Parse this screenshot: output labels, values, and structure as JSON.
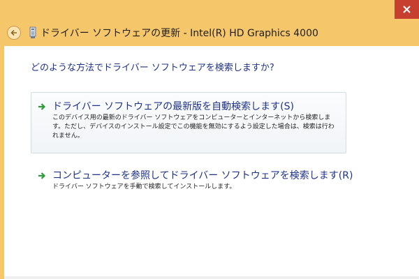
{
  "window": {
    "title": "ドライバー ソフトウェアの更新 - Intel(R) HD Graphics 4000",
    "accent_color": "#f6c66a",
    "close_color": "#c7402f",
    "icons": {
      "back": "back-arrow-icon",
      "device": "device-driver-icon",
      "close": "close-icon"
    }
  },
  "main": {
    "heading": "どのような方法でドライバー ソフトウェアを検索しますか?",
    "options": [
      {
        "title": "ドライバー ソフトウェアの最新版を自動検索します(S)",
        "description": "このデバイス用の最新のドライバー ソフトウェアをコンピューターとインターネットから検索します。ただし、デバイスのインストール設定でこの機能を無効にするよう設定した場合は、検索は行われません。",
        "icon": "green-arrow-icon"
      },
      {
        "title": "コンピューターを参照してドライバー ソフトウェアを検索します(R)",
        "description": "ドライバー ソフトウェアを手動で検索してインストールします。",
        "icon": "green-arrow-icon"
      }
    ]
  }
}
